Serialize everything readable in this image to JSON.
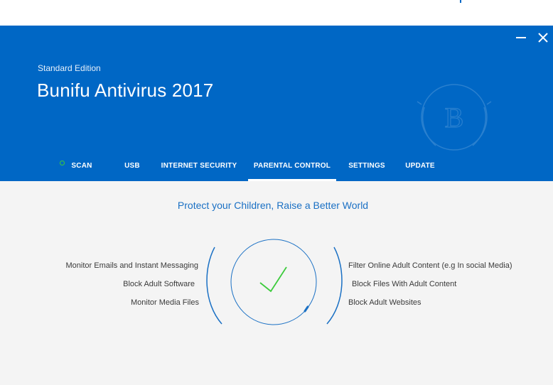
{
  "window": {
    "edition": "Standard Edition",
    "title": "Bunifu Antivirus 2017",
    "minimize_icon": "minimize-icon",
    "close_icon": "close-icon",
    "logo_letter": "B"
  },
  "tabs": [
    {
      "label": "SCAN",
      "active": false,
      "status_icon": "status-ring-icon"
    },
    {
      "label": "USB",
      "active": false
    },
    {
      "label": "INTERNET SECURITY",
      "active": false
    },
    {
      "label": "PARENTAL CONTROL",
      "active": true
    },
    {
      "label": "SETTINGS",
      "active": false
    },
    {
      "label": "UPDATE",
      "active": false
    }
  ],
  "content": {
    "headline": "Protect your Children, Raise a Better World",
    "left_features": [
      "Monitor Emails and Instant Messaging",
      "Block Adult Software",
      "Monitor Media Files"
    ],
    "right_features": [
      "Filter Online Adult Content (e.g In social Media)",
      "Block Files With Adult Content",
      "Block Adult Websites"
    ],
    "status_icon": "checkmark-icon"
  },
  "colors": {
    "accent": "#0067c5",
    "check": "#3ccb3c",
    "headline": "#1a70c4"
  }
}
